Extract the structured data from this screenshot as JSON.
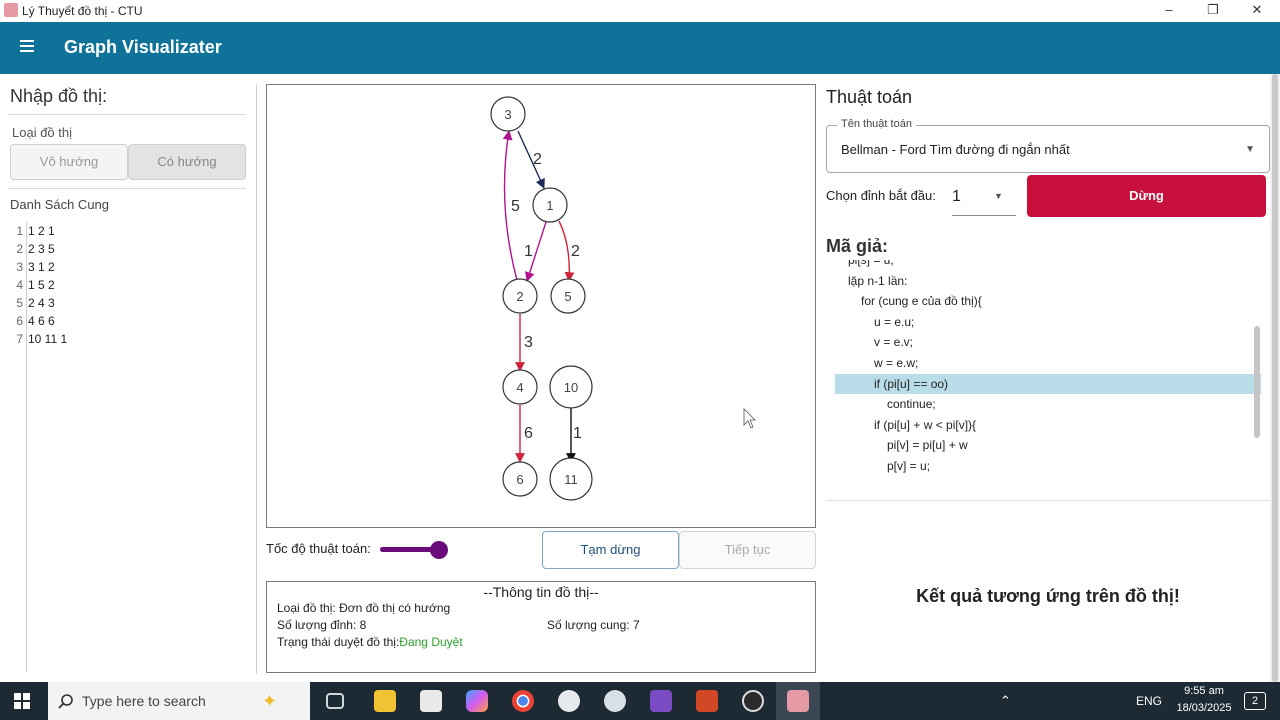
{
  "window": {
    "title": "Lý Thuyết đồ thị - CTU",
    "controls": [
      "–",
      "❐",
      "✕"
    ]
  },
  "app": {
    "title": "Graph Visualizater"
  },
  "input_panel": {
    "heading": "Nhập đồ thị:",
    "graph_type_label": "Loại đồ thị",
    "undirected_label": "Vô hướng",
    "directed_label": "Có hướng",
    "edge_list_label": "Danh Sách Cung",
    "edge_lines": [
      "1 2 1",
      "2 3 5",
      "3 1 2",
      "4 1 5 2",
      "5 2 4 3",
      "6 4 6 6",
      "7 10 11 1"
    ],
    "line_numbers": [
      "1",
      "2",
      "3",
      "4",
      "5",
      "6",
      "7"
    ],
    "edge_texts": [
      "1 2 1",
      "2 3 5",
      "3 1 2",
      "1 5 2",
      "2 4 3",
      "4 6 6",
      "10 11 1"
    ]
  },
  "graph": {
    "nodes": [
      "3",
      "1",
      "2",
      "5",
      "4",
      "10",
      "6",
      "11"
    ],
    "edge_weights": [
      "2",
      "5",
      "1",
      "2",
      "3",
      "6",
      "1"
    ]
  },
  "controls": {
    "speed_label": "Tốc độ thuật toán:",
    "speed_value": 1.0,
    "pause_label": "Tạm dừng",
    "resume_label": "Tiếp tục"
  },
  "info": {
    "title": "--Thông tin đồ thị--",
    "type_label": "Loại đồ thị:",
    "type_value": "Đơn đồ thị có hướng",
    "vertex_count": "Số lượng đỉnh: 8",
    "edge_count": "Số lượng cung: 7",
    "status_label": "Trạng thái duyệt đồ thị:",
    "status_value": "Đang Duyệt",
    "status_color": "#2e9e2e"
  },
  "algorithm_panel": {
    "title": "Thuật toán",
    "field_legend": "Tên thuật toán",
    "selected_algorithm": "Bellman - Ford Tìm đường đi ngắn nhất",
    "start_label": "Chọn đỉnh bắt đầu:",
    "start_value": "1",
    "stop_label": "Dừng",
    "pseudo_title": "Mã giả:",
    "pseudo_lines": [
      "pi[s] = u;",
      "lặp n-1 lần:",
      "for (cung e của đồ thị){",
      "u = e.u;",
      "v = e.v;",
      "w = e.w;",
      "if (pi[u] == oo)",
      "continue;",
      "if (pi[u] + w < pi[v]){",
      "pi[v] = pi[u] + w",
      "p[v] = u;"
    ],
    "highlighted_line": 6,
    "result_text": "Kết quả tương ứng trên đồ thị!"
  },
  "colors": {
    "header": "#0f7299",
    "stop_button": "#c8103c",
    "slider": "#6a0b7b",
    "edge_magenta": "#b0148e",
    "edge_red": "#d0223a",
    "edge_navy": "#1c2a55",
    "highlight": "#b9dde8"
  },
  "taskbar": {
    "search_placeholder": "Type here to search",
    "language": "ENG",
    "time": "9:55 am",
    "date": "18/03/2025",
    "notification_count": "2",
    "icons": [
      "windows-icon",
      "task-view-icon",
      "file-explorer-icon",
      "store-icon",
      "copilot-icon",
      "chrome-icon",
      "zalo-icon",
      "paint-icon",
      "visual-studio-icon",
      "powerpoint-icon",
      "obs-icon",
      "app-icon"
    ]
  }
}
